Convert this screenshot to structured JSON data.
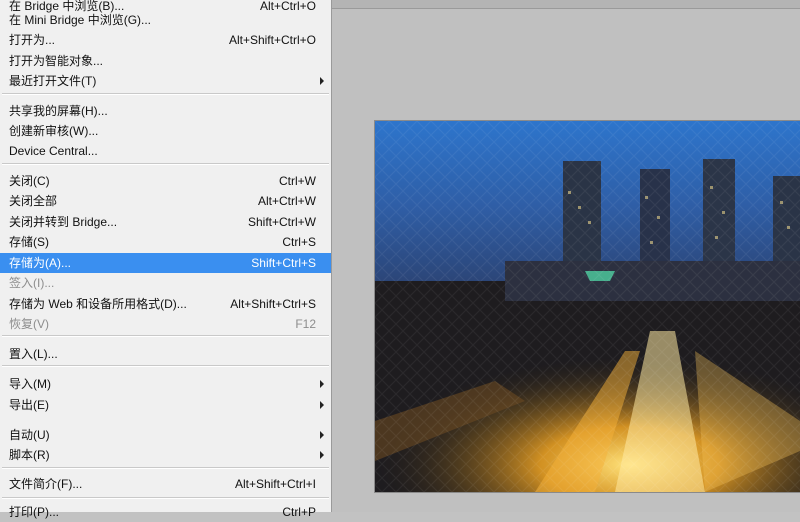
{
  "menu": {
    "items": [
      {
        "label": "在 Bridge 中浏览(B)...",
        "shortcut": "Alt+Ctrl+O",
        "submenu": false,
        "disabled": false
      },
      {
        "label": "在 Mini Bridge 中浏览(G)...",
        "shortcut": "",
        "submenu": false,
        "disabled": false
      },
      {
        "label": "打开为...",
        "shortcut": "Alt+Shift+Ctrl+O",
        "submenu": false,
        "disabled": false
      },
      {
        "label": "打开为智能对象...",
        "shortcut": "",
        "submenu": false,
        "disabled": false
      },
      {
        "label": "最近打开文件(T)",
        "shortcut": "",
        "submenu": true,
        "disabled": false
      },
      {
        "label": "共享我的屏幕(H)...",
        "shortcut": "",
        "submenu": false,
        "disabled": false
      },
      {
        "label": "创建新审核(W)...",
        "shortcut": "",
        "submenu": false,
        "disabled": false
      },
      {
        "label": "Device Central...",
        "shortcut": "",
        "submenu": false,
        "disabled": false
      },
      {
        "label": "关闭(C)",
        "shortcut": "Ctrl+W",
        "submenu": false,
        "disabled": false
      },
      {
        "label": "关闭全部",
        "shortcut": "Alt+Ctrl+W",
        "submenu": false,
        "disabled": false
      },
      {
        "label": "关闭并转到 Bridge...",
        "shortcut": "Shift+Ctrl+W",
        "submenu": false,
        "disabled": false
      },
      {
        "label": "存储(S)",
        "shortcut": "Ctrl+S",
        "submenu": false,
        "disabled": false
      },
      {
        "label": "存储为(A)...",
        "shortcut": "Shift+Ctrl+S",
        "submenu": false,
        "disabled": false,
        "highlighted": true
      },
      {
        "label": "签入(I)...",
        "shortcut": "",
        "submenu": false,
        "disabled": true
      },
      {
        "label": "存储为 Web 和设备所用格式(D)...",
        "shortcut": "Alt+Shift+Ctrl+S",
        "submenu": false,
        "disabled": false
      },
      {
        "label": "恢复(V)",
        "shortcut": "F12",
        "submenu": false,
        "disabled": true
      },
      {
        "label": "置入(L)...",
        "shortcut": "",
        "submenu": false,
        "disabled": false
      },
      {
        "label": "导入(M)",
        "shortcut": "",
        "submenu": true,
        "disabled": false
      },
      {
        "label": "导出(E)",
        "shortcut": "",
        "submenu": true,
        "disabled": false
      },
      {
        "label": "自动(U)",
        "shortcut": "",
        "submenu": true,
        "disabled": false
      },
      {
        "label": "脚本(R)",
        "shortcut": "",
        "submenu": true,
        "disabled": false
      },
      {
        "label": "文件简介(F)...",
        "shortcut": "Alt+Shift+Ctrl+I",
        "submenu": false,
        "disabled": false
      },
      {
        "label": "打印(P)...",
        "shortcut": "Ctrl+P",
        "submenu": false,
        "disabled": false
      }
    ]
  },
  "colors": {
    "highlight": "#3a8ff0",
    "menu_bg": "#f0f0f0",
    "workspace_bg": "#c0c0c0"
  }
}
